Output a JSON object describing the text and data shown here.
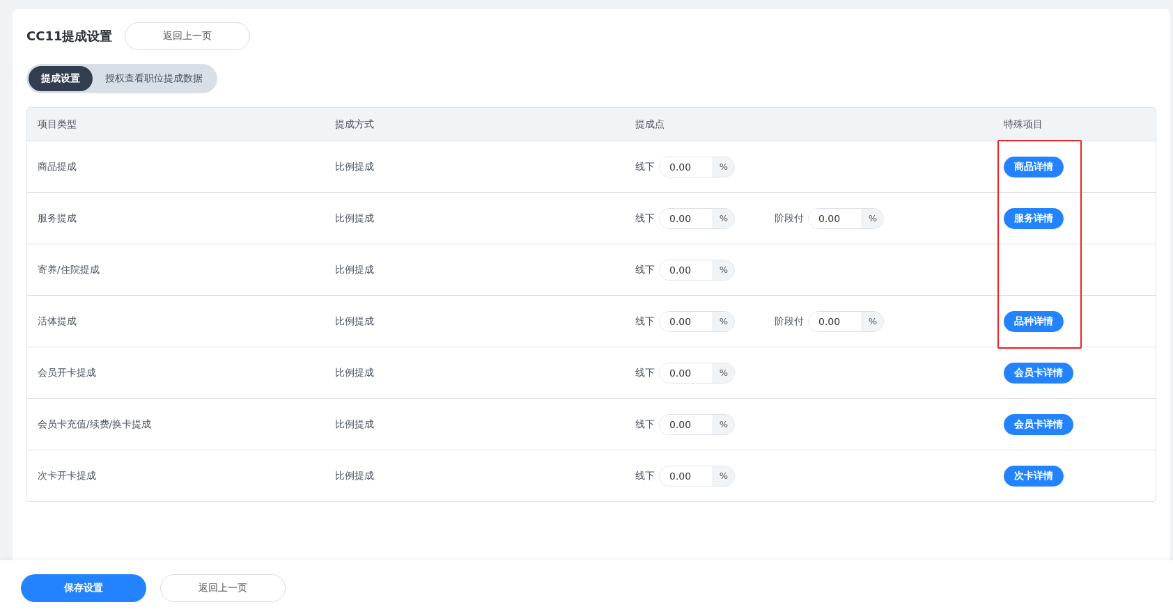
{
  "title": "CC11提成设置",
  "back_button": "返回上一页",
  "tabs": [
    {
      "label": "提成设置",
      "selected": true
    },
    {
      "label": "授权查看职位提成数据",
      "selected": false
    }
  ],
  "table": {
    "columns": [
      "项目类型",
      "提成方式",
      "提成点",
      "特殊项目"
    ],
    "rows": [
      {
        "type": "商品提成",
        "method": "比例提成",
        "rates": [
          {
            "label": "线下",
            "value": "0.00",
            "unit": "%"
          }
        ],
        "detail_button": "商品详情",
        "highlighted": true
      },
      {
        "type": "服务提成",
        "method": "比例提成",
        "rates": [
          {
            "label": "线下",
            "value": "0.00",
            "unit": "%"
          },
          {
            "label": "阶段付",
            "value": "0.00",
            "unit": "%"
          }
        ],
        "detail_button": "服务详情",
        "highlighted": true
      },
      {
        "type": "寄养/住院提成",
        "method": "比例提成",
        "rates": [
          {
            "label": "线下",
            "value": "0.00",
            "unit": "%"
          }
        ],
        "highlighted": true
      },
      {
        "type": "活体提成",
        "method": "比例提成",
        "rates": [
          {
            "label": "线下",
            "value": "0.00",
            "unit": "%"
          },
          {
            "label": "阶段付",
            "value": "0.00",
            "unit": "%"
          }
        ],
        "detail_button": "品种详情",
        "highlighted": true
      },
      {
        "type": "会员开卡提成",
        "method": "比例提成",
        "rates": [
          {
            "label": "线下",
            "value": "0.00",
            "unit": "%"
          }
        ],
        "detail_button": "会员卡详情",
        "highlighted": false
      },
      {
        "type": "会员卡充值/续费/换卡提成",
        "method": "比例提成",
        "rates": [
          {
            "label": "线下",
            "value": "0.00",
            "unit": "%"
          }
        ],
        "detail_button": "会员卡详情",
        "highlighted": false
      },
      {
        "type": "次卡开卡提成",
        "method": "比例提成",
        "rates": [
          {
            "label": "线下",
            "value": "0.00",
            "unit": "%"
          }
        ],
        "detail_button": "次卡详情",
        "highlighted": false
      }
    ]
  },
  "footer": {
    "save_button": "保存设置",
    "back_button": "返回上一页"
  }
}
